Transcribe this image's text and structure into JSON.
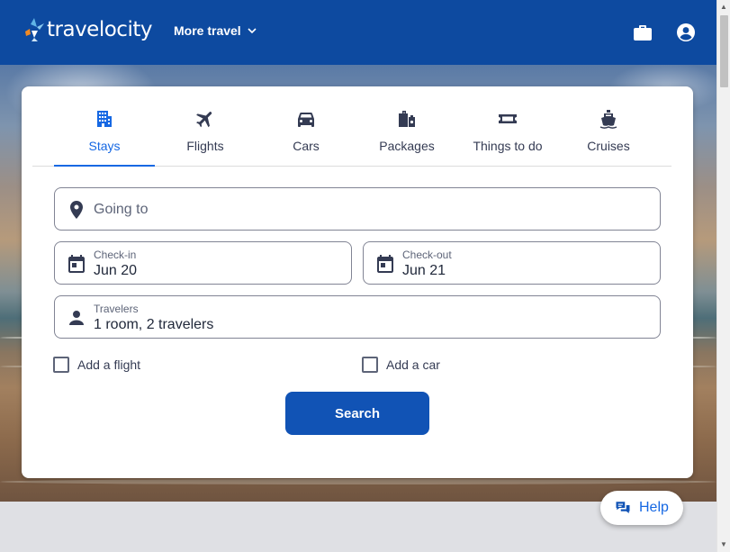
{
  "header": {
    "logo_text": "travelocity",
    "more_travel_label": "More travel",
    "trips_icon": "briefcase-icon",
    "account_icon": "account-circle-icon",
    "background_color": "#0d4aa0"
  },
  "tabs": [
    {
      "label": "Stays",
      "icon": "hotel-icon",
      "active": true
    },
    {
      "label": "Flights",
      "icon": "airplane-icon",
      "active": false
    },
    {
      "label": "Cars",
      "icon": "car-icon",
      "active": false
    },
    {
      "label": "Packages",
      "icon": "luggage-icon",
      "active": false
    },
    {
      "label": "Things to do",
      "icon": "ticket-icon",
      "active": false
    },
    {
      "label": "Cruises",
      "icon": "cruise-ship-icon",
      "active": false
    }
  ],
  "form": {
    "destination": {
      "placeholder": "Going to",
      "value": "",
      "icon": "location-pin-icon"
    },
    "checkin": {
      "label": "Check-in",
      "value": "Jun 20",
      "icon": "calendar-icon"
    },
    "checkout": {
      "label": "Check-out",
      "value": "Jun 21",
      "icon": "calendar-icon"
    },
    "travelers": {
      "label": "Travelers",
      "value": "1 room, 2 travelers",
      "icon": "person-icon"
    },
    "add_flight": {
      "label": "Add a flight",
      "checked": false
    },
    "add_car": {
      "label": "Add a car",
      "checked": false
    },
    "search_label": "Search"
  },
  "help": {
    "label": "Help",
    "icon": "chat-bubbles-icon"
  },
  "colors": {
    "accent": "#1668e3",
    "button": "#1153b5",
    "text": "#343b53"
  }
}
